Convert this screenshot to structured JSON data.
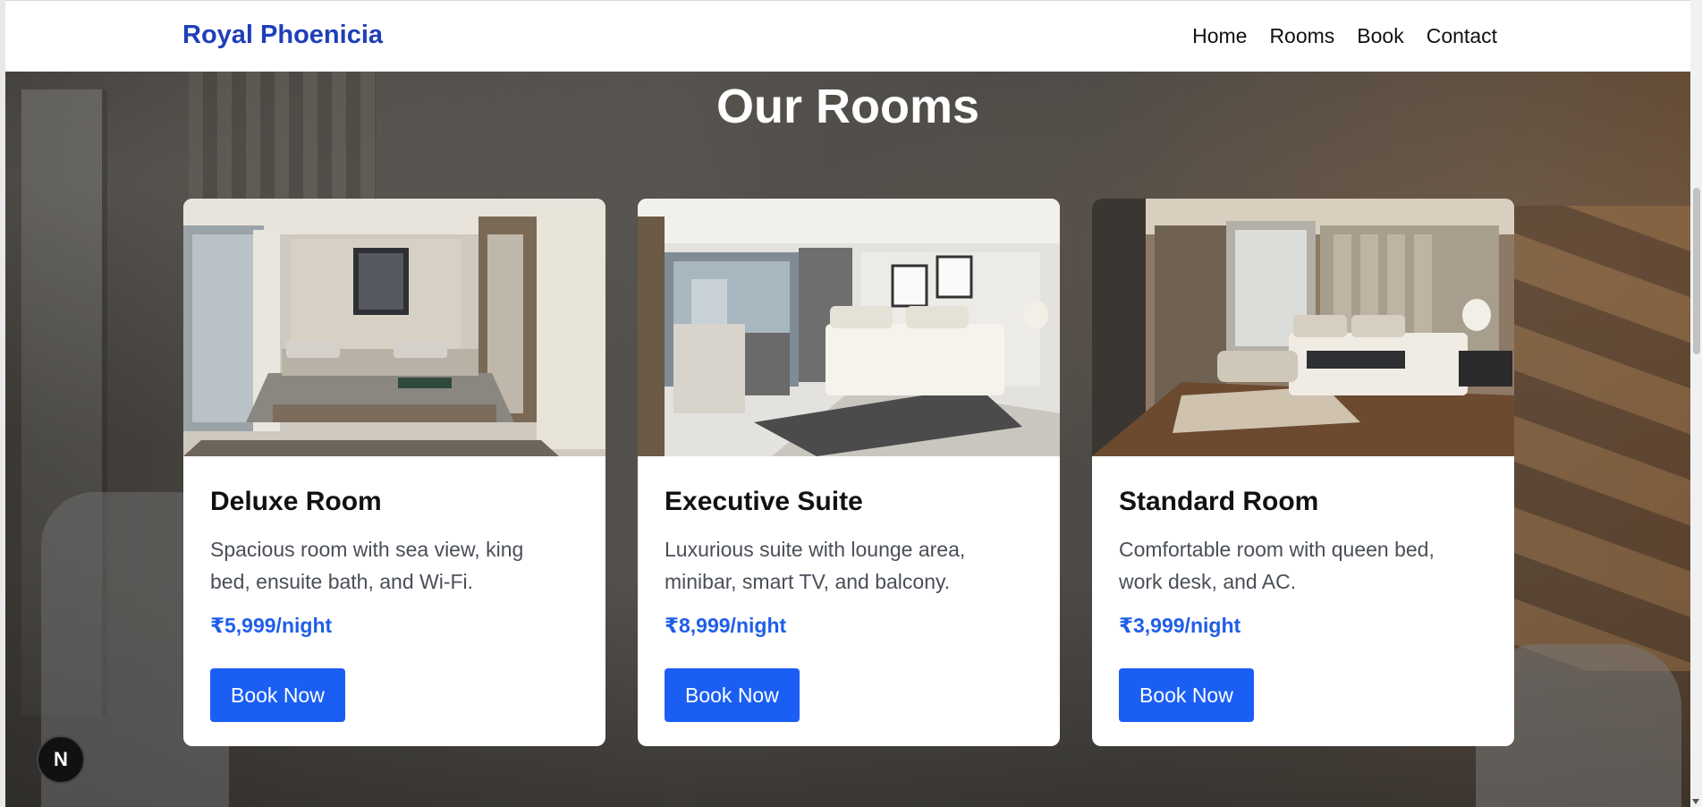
{
  "navbar": {
    "brand": "Royal Phoenicia",
    "links": [
      "Home",
      "Rooms",
      "Book",
      "Contact"
    ]
  },
  "section": {
    "title": "Our Rooms"
  },
  "rooms": [
    {
      "name": "Deluxe Room",
      "description": "Spacious room with sea view, king bed, ensuite bath, and Wi-Fi.",
      "price": "₹5,999/night",
      "button_label": "Book Now"
    },
    {
      "name": "Executive Suite",
      "description": "Luxurious suite with lounge area, minibar, smart TV, and balcony.",
      "price": "₹8,999/night",
      "button_label": "Book Now"
    },
    {
      "name": "Standard Room",
      "description": "Comfortable room with queen bed, work desk, and AC.",
      "price": "₹3,999/night",
      "button_label": "Book Now"
    }
  ],
  "dev_badge": {
    "letter": "N"
  },
  "colors": {
    "brand": "#1f3fb8",
    "price": "#1f5ee8",
    "button": "#1a5ef4"
  }
}
